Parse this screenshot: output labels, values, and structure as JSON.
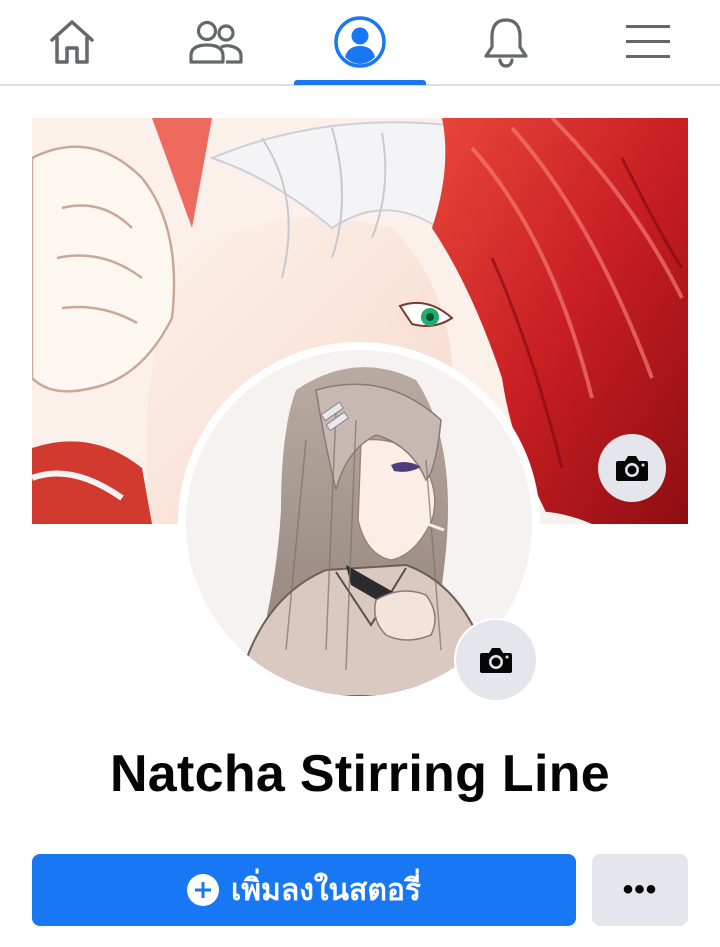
{
  "nav": {
    "tabs": [
      {
        "icon": "home-icon",
        "active": false
      },
      {
        "icon": "friends-icon",
        "active": false
      },
      {
        "icon": "profile-icon",
        "active": true
      },
      {
        "icon": "bell-icon",
        "active": false
      },
      {
        "icon": "menu-icon",
        "active": false
      }
    ],
    "accent_color": "#1877f2",
    "icon_color": "#65676b"
  },
  "cover": {
    "camera_icon": "camera-icon"
  },
  "profile": {
    "name": "Natcha Stirring Line",
    "camera_icon": "camera-icon"
  },
  "actions": {
    "add_story_label": "เพิ่มลงในสตอรี่",
    "add_story_icon": "plus-circle-icon",
    "more_label": "•••",
    "primary_color": "#1877f2",
    "secondary_color": "#e4e6eb"
  }
}
